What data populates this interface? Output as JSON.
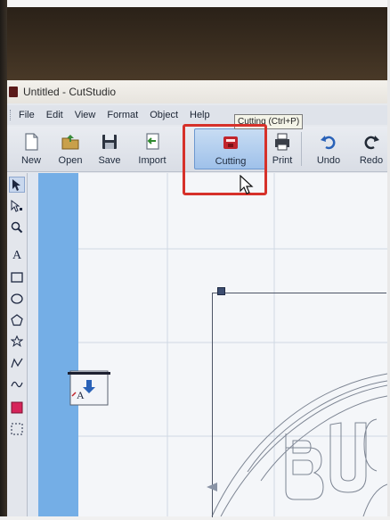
{
  "window": {
    "title": "Untitled - CutStudio"
  },
  "menu": {
    "items": [
      "File",
      "Edit",
      "View",
      "Format",
      "Object",
      "Help"
    ]
  },
  "toolbar": {
    "buttons": [
      {
        "label": "New",
        "icon": "new-document-icon"
      },
      {
        "label": "Open",
        "icon": "open-folder-icon"
      },
      {
        "label": "Save",
        "icon": "save-disk-icon"
      },
      {
        "label": "Import",
        "icon": "import-icon"
      },
      {
        "label": "Cutting",
        "icon": "cutting-plotter-icon",
        "active": true
      },
      {
        "label": "Print",
        "icon": "print-icon"
      },
      {
        "label": "Undo",
        "icon": "undo-arrow-icon"
      },
      {
        "label": "Redo",
        "icon": "redo-arrow-icon"
      }
    ],
    "tooltip": "Cutting (Ctrl+P)"
  },
  "tools": [
    "select-arrow-icon",
    "node-edit-arrow-icon",
    "zoom-magnifier-icon",
    "text-tool-icon",
    "rectangle-tool-icon",
    "ellipse-tool-icon",
    "polygon-tool-icon",
    "star-tool-icon",
    "polyline-tool-icon",
    "curve-tool-icon",
    "fill-color-swatch-icon",
    "dotted-rect-select-icon"
  ],
  "canvas": {
    "design_text": "BUC",
    "media_icon_label": "A"
  },
  "colors": {
    "highlight": "#d6312a",
    "margin_blue": "#74aee6",
    "cutting_red": "#c0242c",
    "toolbar_active": "#9fc1ea"
  }
}
